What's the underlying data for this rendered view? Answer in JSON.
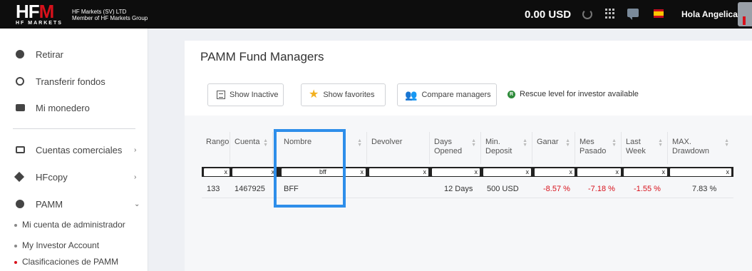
{
  "header": {
    "logo_text": "HFM",
    "logo_sub": "HF MARKETS",
    "company_line1": "HF Markets (SV) LTD",
    "company_line2": "Member of HF Markets Group",
    "balance": "0.00 USD",
    "greeting": "Hola Angelica"
  },
  "sidebar": {
    "items": [
      {
        "label": "Retirar",
        "icon": "withdraw-icon"
      },
      {
        "label": "Transferir fondos",
        "icon": "transfer-icon"
      },
      {
        "label": "Mi monedero",
        "icon": "wallet-icon"
      },
      {
        "label": "Cuentas comerciales",
        "icon": "chart-icon",
        "chevron": "›"
      },
      {
        "label": "HFcopy",
        "icon": "layers-icon",
        "chevron": "›"
      },
      {
        "label": "PAMM",
        "icon": "pamm-icon",
        "chevron": "⌄"
      }
    ],
    "sub_items": [
      {
        "label": "Mi cuenta de administrador"
      },
      {
        "label": "My Investor Account"
      },
      {
        "label": "Clasificaciones de PAMM"
      }
    ]
  },
  "main": {
    "title": "PAMM Fund Managers",
    "buttons": {
      "show_inactive": "Show Inactive",
      "show_favorites": "Show favorites",
      "compare_managers": "Compare managers"
    },
    "rescue_note": "Rescue level for investor available",
    "rescue_badge": "R"
  },
  "table": {
    "columns": [
      {
        "line1": "Rango",
        "line2": ""
      },
      {
        "line1": "Cuenta",
        "line2": ""
      },
      {
        "line1": "Nombre",
        "line2": ""
      },
      {
        "line1": "Devolver",
        "line2": ""
      },
      {
        "line1": "Days",
        "line2": "Opened"
      },
      {
        "line1": "Min.",
        "line2": "Deposit"
      },
      {
        "line1": "Ganar",
        "line2": ""
      },
      {
        "line1": "Mes",
        "line2": "Pasado"
      },
      {
        "line1": "Last",
        "line2": "Week"
      },
      {
        "line1": "MAX.",
        "line2": "Drawdown"
      }
    ],
    "filter_clear": "x",
    "nombre_filter_value": "bff",
    "rows": [
      {
        "rango": "133",
        "cuenta": "1467925",
        "nombre": "BFF",
        "devolver": "",
        "days_opened": "12 Days",
        "min_deposit": "500 USD",
        "ganar": "-8.57 %",
        "mes_pasado": "-7.18 %",
        "last_week": "-1.55 %",
        "max_drawdown": "7.83 %"
      }
    ]
  },
  "colors": {
    "brand_red": "#d8111b",
    "highlight_blue": "#2e8eea",
    "negative": "#d8111b"
  }
}
